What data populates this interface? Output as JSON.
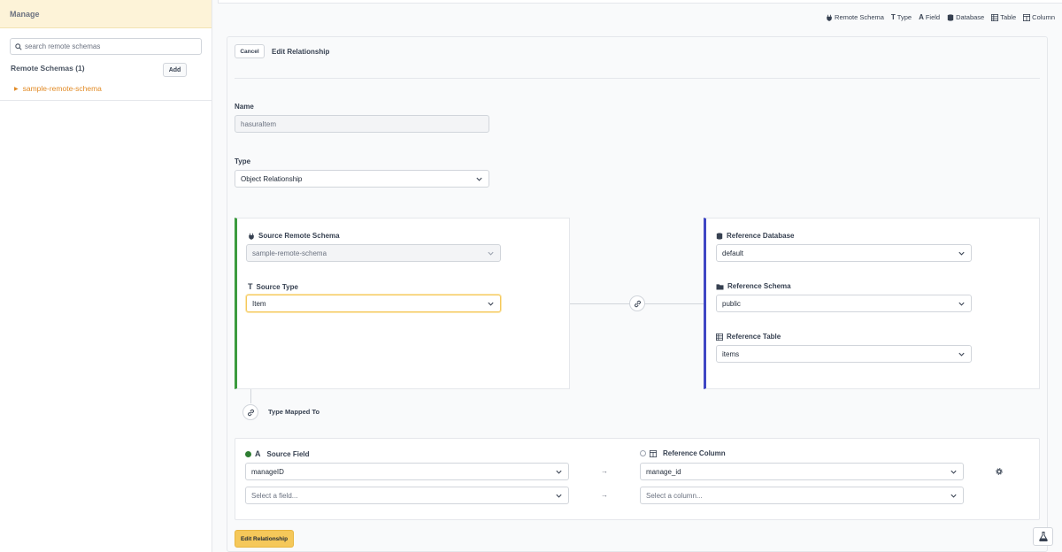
{
  "sidebar": {
    "header": "Manage",
    "search_placeholder": "search remote schemas",
    "remote_schemas_label": "Remote Schemas (1)",
    "add_label": "Add",
    "items": [
      {
        "label": "sample-remote-schema"
      }
    ]
  },
  "legend": {
    "items": [
      {
        "icon": "plug-icon",
        "label": "Remote Schema"
      },
      {
        "icon": "type-icon",
        "label": "Type"
      },
      {
        "icon": "field-icon",
        "label": "Field"
      },
      {
        "icon": "database-icon",
        "label": "Database"
      },
      {
        "icon": "table-icon",
        "label": "Table"
      },
      {
        "icon": "column-icon",
        "label": "Column"
      }
    ]
  },
  "form": {
    "cancel_label": "Cancel",
    "title": "Edit Relationship",
    "name_label": "Name",
    "name_value": "hasuraItem",
    "type_label": "Type",
    "type_value": "Object Relationship",
    "source_remote_schema_label": "Source Remote Schema",
    "source_remote_schema_value": "sample-remote-schema",
    "source_type_label": "Source Type",
    "source_type_value": "Item",
    "reference_database_label": "Reference Database",
    "reference_database_value": "default",
    "reference_schema_label": "Reference Schema",
    "reference_schema_value": "public",
    "reference_table_label": "Reference Table",
    "reference_table_value": "items",
    "type_mapped_to_label": "Type Mapped To",
    "source_field_label": "Source Field",
    "reference_column_label": "Reference Column",
    "mappings": [
      {
        "source": "manageID",
        "arrow": "→",
        "column": "manage_id"
      },
      {
        "source": "Select a field...",
        "arrow": "→",
        "column": "Select a column..."
      }
    ],
    "submit_label": "Edit Relationship"
  },
  "colors": {
    "accent": "#f5c85a",
    "source_border": "#3b9b3e",
    "reference_border": "#3f47c4",
    "sidebar_link": "#e28b26"
  }
}
